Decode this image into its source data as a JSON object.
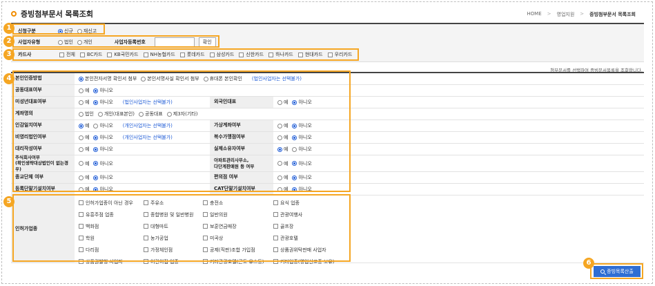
{
  "header": {
    "title": "증빙첨부문서 목록조회",
    "breadcrumb": [
      "HOME",
      "영업지원",
      "증빙첨부문서 목록조회"
    ]
  },
  "filters": {
    "apply_type": {
      "label": "신청구분",
      "options": [
        "신규",
        "재신고"
      ],
      "selected": "신규"
    },
    "biz_type": {
      "label": "사업자유형",
      "options": [
        "법인",
        "개인"
      ],
      "selected": ""
    },
    "biz_no": {
      "label": "사업자등록번호",
      "value": "",
      "button": "확인"
    },
    "cards": {
      "label": "카드사",
      "options": [
        "전체",
        "BC카드",
        "KB국민카드",
        "NH농협카드",
        "롯데카드",
        "삼성카드",
        "신한카드",
        "하나카드",
        "현대카드",
        "우리카드"
      ]
    }
  },
  "hint": "첨부문서를 선택하여 증빙문서목록을 조회합니다.",
  "form": {
    "verify": {
      "label": "본인인증방법",
      "options": [
        "본인전자서명 확인서 첨부",
        "본인서명사실 확인서 첨부",
        "휴대폰 본인확인"
      ],
      "selected": "본인전자서명 확인서 첨부",
      "note": "(법인사업자는 선택불가)"
    },
    "joint": {
      "label": "공동대표여부",
      "yes": "예",
      "no": "아니오"
    },
    "minor": {
      "label": "미성년대표여부",
      "note": "(법인사업자는 선택불가)"
    },
    "foreign": {
      "label": "외국인대표"
    },
    "account": {
      "label": "계좌명의",
      "options": [
        "법인",
        "개인(대표본인)",
        "공동대표",
        "제3자(기타)"
      ]
    },
    "seal": {
      "label": "인감일치여부",
      "note": "(개인사업자는 선택불가)"
    },
    "virtual": {
      "label": "가상계좌여부"
    },
    "nonprofit": {
      "label": "비영리법인여부",
      "note": "(개인사업자는 선택불가)"
    },
    "multi": {
      "label": "복수가맹점여부"
    },
    "agent": {
      "label": "대리작성여부"
    },
    "owner": {
      "label": "실제소유자여부"
    },
    "stock": {
      "label": "주식회사여부\n(확인생략대상법인이 없는경우)"
    },
    "apt": {
      "label": "아파트관리사무소,\n다단계판매원 등 여부"
    },
    "final": {
      "label": "종교단체 여부"
    },
    "conv": {
      "label": "편의점 여부"
    },
    "reg": {
      "label": "등록단말기설치여부"
    },
    "cat": {
      "label": "CAT단말기설치여부"
    },
    "license": {
      "label": "인허가업종",
      "items": [
        "인허가업종이 아닌 경우",
        "주유소",
        "충전소",
        "요식 업종",
        "유흥주점 업종",
        "종합병원 및 일반병원",
        "일반의원",
        "관광여행사",
        "백화점",
        "대형마트",
        "보훈연금매장",
        "골프장",
        "학원",
        "농가공업",
        "미곡상",
        "관광호텔",
        "다리점",
        "가정체인점",
        "공제(직판)조합 가입점",
        "상품권위탁판매 사업자",
        "상품권발행 사업자",
        "어린이집 업종",
        "기타관광호텔(콘도 유스등)",
        "기타업종(영업신고증 보유)"
      ]
    }
  },
  "submit_label": "증빙목록산출",
  "badges": [
    "1",
    "2",
    "3",
    "4",
    "5",
    "6"
  ],
  "colors": {
    "accent": "#f5a623",
    "primary": "#2f6ed3",
    "note": "#1e5bd6"
  }
}
